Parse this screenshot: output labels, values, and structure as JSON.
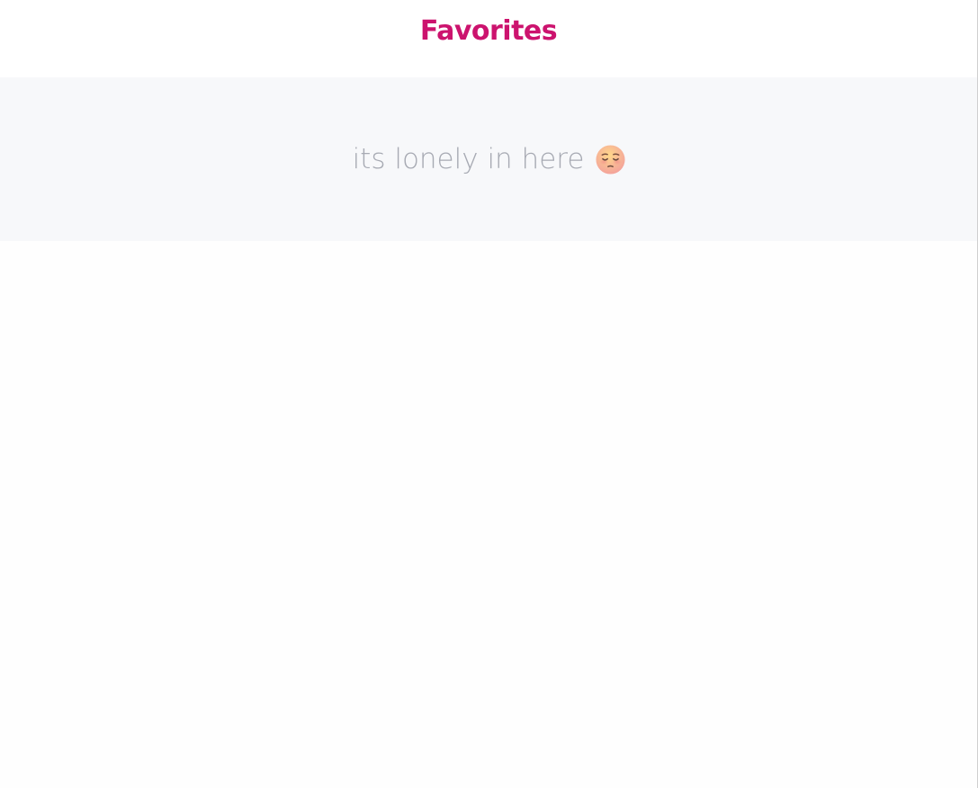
{
  "header": {
    "title": "Favorites"
  },
  "empty_state": {
    "message": "its lonely in here",
    "icon": "pensive-face-icon"
  },
  "colors": {
    "title": "#cc136e",
    "empty_text": "#a7aab3",
    "panel_background": "#f7f8fa",
    "page_background": "#fefefe"
  }
}
